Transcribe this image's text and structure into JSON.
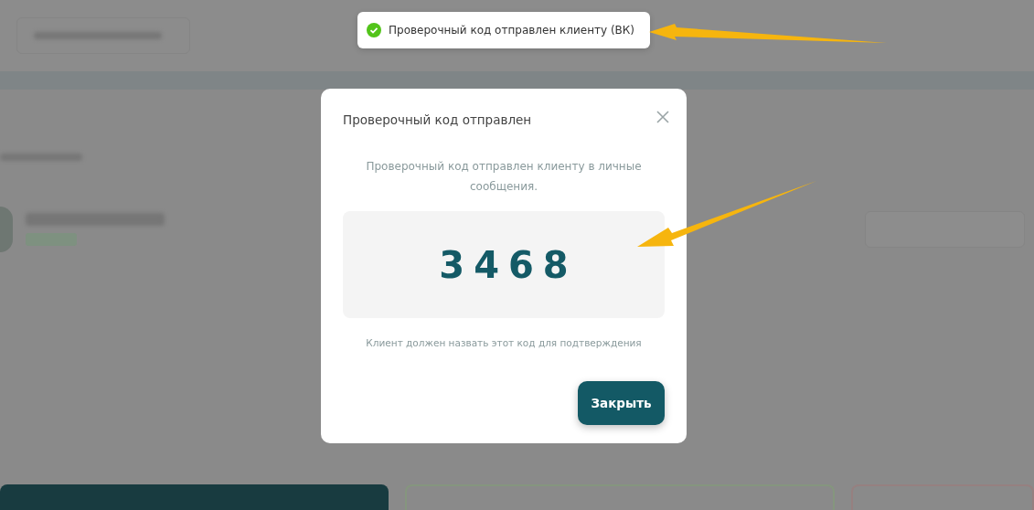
{
  "toast": {
    "kind": "success",
    "text": "Проверочный код отправлен клиенту (ВК)"
  },
  "modal": {
    "title": "Проверочный код отправлен",
    "message": "Проверочный код отправлен клиенту в личные сообщения.",
    "code": "3468",
    "hint": "Клиент должен назвать этот код для подтверждения",
    "close_button": "Закрыть"
  }
}
